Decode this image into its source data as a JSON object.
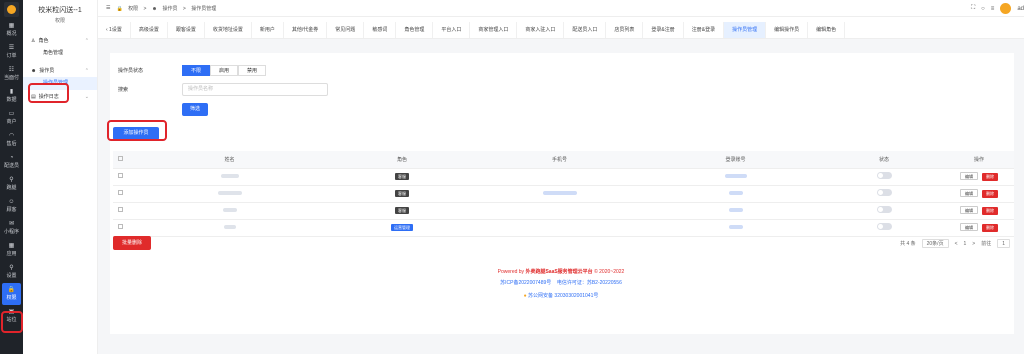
{
  "rail": [
    {
      "icon": "overview-icon",
      "glyph": "▦",
      "label": "概况"
    },
    {
      "icon": "order-icon",
      "glyph": "☰",
      "label": "订单"
    },
    {
      "icon": "pay-icon",
      "glyph": "☷",
      "label": "当面付"
    },
    {
      "icon": "data-icon",
      "glyph": "▮",
      "label": "数据"
    },
    {
      "icon": "merchant-icon",
      "glyph": "▭",
      "label": "商户"
    },
    {
      "icon": "aftersale-icon",
      "glyph": "◠",
      "label": "售后"
    },
    {
      "icon": "delivery-icon",
      "glyph": "◔",
      "label": "配送员"
    },
    {
      "icon": "rider-icon",
      "glyph": "⚲",
      "label": "跑腿"
    },
    {
      "icon": "customer-icon",
      "glyph": "☺",
      "label": "顾客"
    },
    {
      "icon": "miniprogram-icon",
      "glyph": "✉",
      "label": "小程序"
    },
    {
      "icon": "app-icon",
      "glyph": "▦",
      "label": "应用"
    },
    {
      "icon": "settings-icon",
      "glyph": "⚲",
      "label": "设置"
    },
    {
      "icon": "lock-icon",
      "glyph": "🔒",
      "label": "权限"
    },
    {
      "icon": "site-icon",
      "glyph": "▣",
      "label": "站位"
    }
  ],
  "sidebar": {
    "shop_name": "校米粒闪送--1",
    "shop_sub": "权限",
    "groups": [
      {
        "label": "角色",
        "items": [
          "角色管理"
        ]
      },
      {
        "label": "操作员",
        "items": [
          "操作员管理"
        ]
      },
      {
        "label": "操作日志",
        "items": []
      }
    ]
  },
  "header": {
    "breadcrumb": [
      "权限",
      ">",
      "操作员",
      ">",
      "操作员管理"
    ],
    "user": "ad"
  },
  "tabs": [
    "‹ 1设置",
    "高级设置",
    "跟客设置",
    "收货地址设置",
    "新用户",
    "其他/代金券",
    "常见问题",
    "敏感词",
    "角色管理",
    "平台入口",
    "商家管理入口",
    "商家入驻入口",
    "配送员入口",
    "店员列表",
    "登录&注册",
    "注册&登录",
    "操作员管理",
    "编辑操作员",
    "编辑角色"
  ],
  "filter": {
    "status_label": "操作员状态",
    "status_options": [
      "不限",
      "启用",
      "禁用"
    ],
    "search_label": "搜索",
    "search_placeholder": "操作员名称",
    "submit": "筛选"
  },
  "table": {
    "add_button": "添加操作员",
    "columns": [
      "姓名",
      "角色",
      "手机号",
      "登录账号",
      "状态",
      "操作"
    ],
    "rows": [
      {
        "role": "客服"
      },
      {
        "role": "客服"
      },
      {
        "role": "客服"
      },
      {
        "role": "运营管理"
      }
    ],
    "edit": "编辑",
    "delete": "删除",
    "batch_delete": "批量删除"
  },
  "pager": {
    "total": "共 4 条",
    "size": "20条/页",
    "prev": "<",
    "page": "1",
    "next": ">",
    "goto": "前往",
    "goto_val": "1"
  },
  "footer": {
    "powered_prefix": "Powered by",
    "brand": "外卖跑腿SaaS服务管理云平台",
    "copy": "© 2020~2022",
    "icp": "苏ICP备2022007489号",
    "license": "电信许可证：苏B2-20220556",
    "police": "苏公网安备 32030302001041号"
  },
  "colors": {
    "primary": "#2e6ef5",
    "danger": "#e02b2b",
    "rail": "#1f2329"
  }
}
